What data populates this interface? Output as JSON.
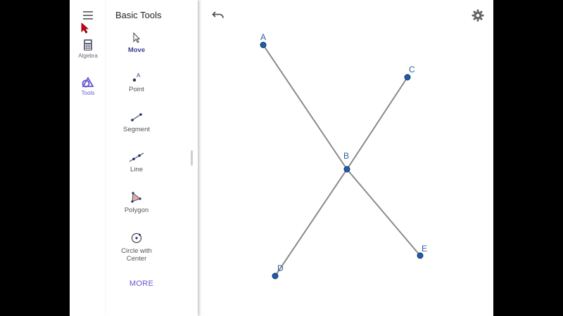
{
  "rail": {
    "algebra_label": "Algebra",
    "tools_label": "Tools"
  },
  "tools_panel": {
    "title": "Basic Tools",
    "tools": [
      {
        "label": "Move",
        "icon": "move-cursor-icon",
        "active": true
      },
      {
        "label": "Point",
        "icon": "point-icon",
        "icon_text": "A"
      },
      {
        "label": "Segment",
        "icon": "segment-icon"
      },
      {
        "label": "Line",
        "icon": "line-icon"
      },
      {
        "label": "Polygon",
        "icon": "polygon-icon"
      },
      {
        "label_line1": "Circle with",
        "label_line2": "Center",
        "icon": "circle-with-center-icon"
      }
    ],
    "more_label": "MORE"
  },
  "toolbar": {
    "undo_icon": "undo-icon",
    "settings_icon": "gear-icon"
  },
  "graphics": {
    "points": [
      {
        "name": "A"
      },
      {
        "name": "B"
      },
      {
        "name": "C"
      },
      {
        "name": "D"
      },
      {
        "name": "E"
      }
    ],
    "line_color": "#8a8a8a",
    "point_color": "#1e5fa8",
    "label_color": "#2a5fa0"
  },
  "colors": {
    "accent": "#6557d2",
    "active_tool_text": "#3b3f8f"
  }
}
